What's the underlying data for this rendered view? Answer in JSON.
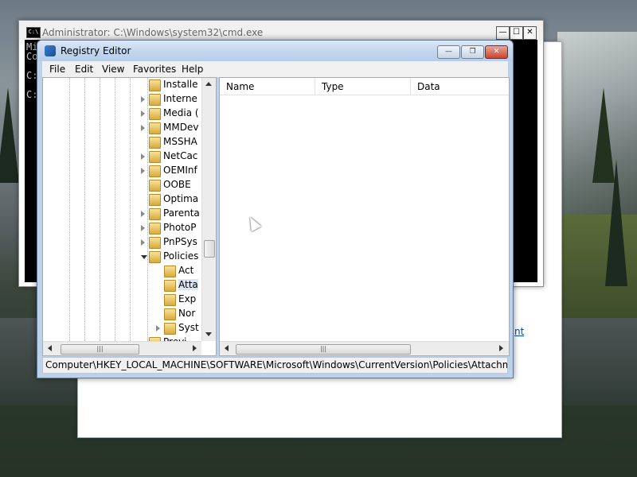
{
  "cmd": {
    "title": "Administrator: C:\\Windows\\system32\\cmd.exe",
    "icon_text": "C:\\",
    "lines": [
      "Mi",
      "Co",
      "",
      "C:",
      "",
      "C:"
    ],
    "minimize": "—",
    "maximize": "☐",
    "close": "✕"
  },
  "dialog": {
    "link_text": "nt"
  },
  "regedit": {
    "title": "Registry Editor",
    "minimize": "—",
    "maximize": "❐",
    "close": "✕",
    "menu": [
      "File",
      "Edit",
      "View",
      "Favorites",
      "Help"
    ],
    "tree": [
      {
        "label": "Installe",
        "expander": "none"
      },
      {
        "label": "Interne",
        "expander": "collapsed"
      },
      {
        "label": "Media (",
        "expander": "collapsed"
      },
      {
        "label": "MMDev",
        "expander": "collapsed"
      },
      {
        "label": "MSSHA",
        "expander": "none"
      },
      {
        "label": "NetCac",
        "expander": "collapsed"
      },
      {
        "label": "OEMInf",
        "expander": "collapsed"
      },
      {
        "label": "OOBE",
        "expander": "none"
      },
      {
        "label": "Optima",
        "expander": "none"
      },
      {
        "label": "Parenta",
        "expander": "collapsed"
      },
      {
        "label": "PhotoP",
        "expander": "collapsed"
      },
      {
        "label": "PnPSys",
        "expander": "collapsed"
      },
      {
        "label": "Policies",
        "expander": "expanded"
      },
      {
        "label": "Act",
        "expander": "none",
        "child": true
      },
      {
        "label": "Atta",
        "expander": "none",
        "child": true,
        "selected": true
      },
      {
        "label": "Exp",
        "expander": "none",
        "child": true
      },
      {
        "label": "Nor",
        "expander": "none",
        "child": true
      },
      {
        "label": "Syst",
        "expander": "collapsed",
        "child": true
      },
      {
        "label": "Previ",
        "expander": "none"
      }
    ],
    "columns": [
      "Name",
      "Type",
      "Data"
    ],
    "status_path": "Computer\\HKEY_LOCAL_MACHINE\\SOFTWARE\\Microsoft\\Windows\\CurrentVersion\\Policies\\Attachments",
    "scroll_grip": "|||"
  }
}
